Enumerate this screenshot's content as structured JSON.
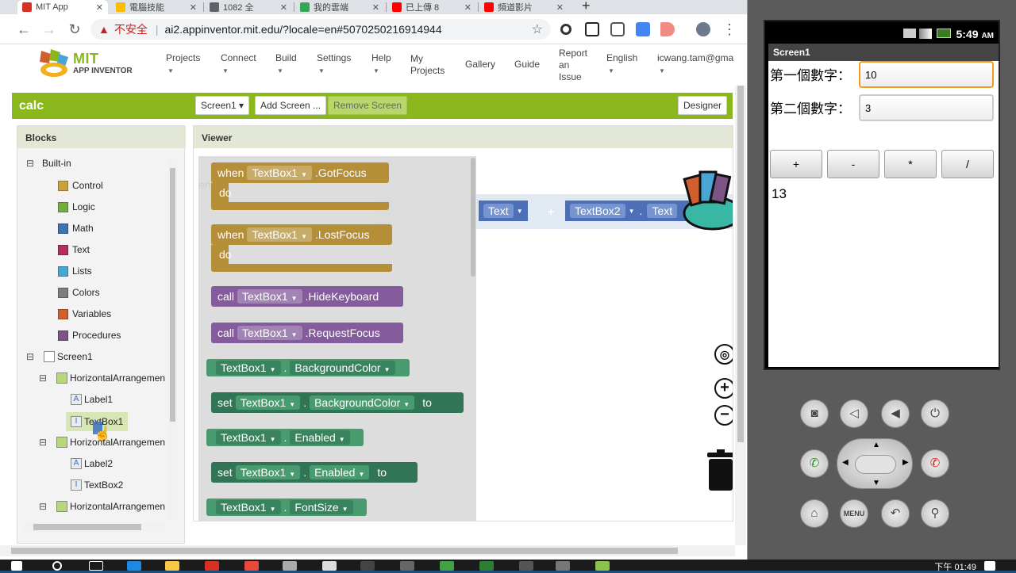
{
  "browser": {
    "tabs": [
      {
        "title": "MIT App",
        "color": "#d93025"
      },
      {
        "title": "電腦技能",
        "color": "#fbbc04"
      },
      {
        "title": "1082 全",
        "color": "#5f6368"
      },
      {
        "title": "我的雲端",
        "color": "#34a853"
      },
      {
        "title": "已上傳 8",
        "color": "#ff0000"
      },
      {
        "title": "頻道影片",
        "color": "#ff0000"
      }
    ],
    "insecure_label": "不安全",
    "url": "ai2.appinventor.mit.edu/?locale=en#5070250216914944"
  },
  "appinventor": {
    "logo_title": "MIT",
    "logo_subtitle": "APP INVENTOR",
    "menu": [
      {
        "label": "Projects",
        "caret": true
      },
      {
        "label": "Connect",
        "caret": true
      },
      {
        "label": "Build",
        "caret": true
      },
      {
        "label": "Settings",
        "caret": true
      },
      {
        "label": "Help",
        "caret": true
      },
      {
        "label": "My\nProjects",
        "caret": false
      },
      {
        "label": "Gallery",
        "caret": false
      },
      {
        "label": "Guide",
        "caret": false
      },
      {
        "label": "Report\nan\nIssue",
        "caret": false
      },
      {
        "label": "English",
        "caret": true
      },
      {
        "label": "icwang.tam@gma",
        "caret": true
      }
    ],
    "project_name": "calc",
    "screen_select": "Screen1 ▾",
    "add_screen": "Add Screen ...",
    "remove_screen": "Remove Screen",
    "designer": "Designer"
  },
  "blocks_panel": {
    "header": "Blocks",
    "builtin_label": "Built-in",
    "builtin": [
      {
        "label": "Control",
        "color": "#c8a33b"
      },
      {
        "label": "Logic",
        "color": "#77ab41"
      },
      {
        "label": "Math",
        "color": "#3f71b5"
      },
      {
        "label": "Text",
        "color": "#b32d5e"
      },
      {
        "label": "Lists",
        "color": "#49a6d4"
      },
      {
        "label": "Colors",
        "color": "#7d7d7d"
      },
      {
        "label": "Variables",
        "color": "#d05f2d"
      },
      {
        "label": "Procedures",
        "color": "#7c5385"
      }
    ],
    "components": {
      "screen": "Screen1",
      "ha1": "HorizontalArrangemen",
      "label1": "Label1",
      "textbox1": "TextBox1",
      "ha2": "HorizontalArrangemen",
      "label2": "Label2",
      "textbox2": "TextBox2",
      "ha3": "HorizontalArrangemen"
    }
  },
  "viewer": {
    "header": "Viewer",
    "component": "TextBox1",
    "kw_when": "when",
    "kw_do": "do",
    "kw_call": "call",
    "kw_set": "set",
    "kw_to": "to",
    "dot": ".",
    "gotfocus": ".GotFocus",
    "lostfocus": ".LostFocus",
    "hidekeyboard": ".HideKeyboard",
    "requestfocus": ".RequestFocus",
    "bgcolor": "BackgroundColor",
    "enabled": "Enabled",
    "fontsize": "FontSize",
    "workspace": {
      "textbox2": "TextBox2",
      "text": "Text",
      "plus": "+"
    }
  },
  "emulator": {
    "clock": "5:49",
    "clock_ampm": "AM",
    "screen_title": "Screen1",
    "label1": "第一個數字：",
    "textbox1_value": "10",
    "label2": "第二個數字：",
    "textbox2_value": "3",
    "buttons": [
      "+",
      "-",
      "*",
      "/"
    ],
    "result": "13"
  },
  "taskbar": {
    "clock": "下午 01:49"
  }
}
